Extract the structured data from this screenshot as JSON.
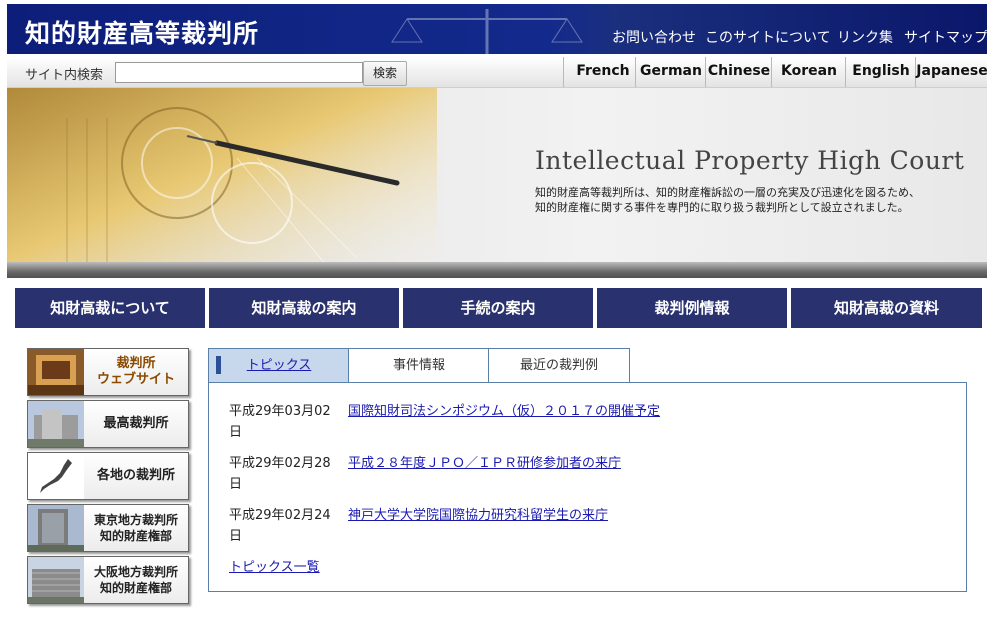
{
  "header": {
    "site_title": "知的財産高等裁判所",
    "links": [
      "お問い合わせ",
      "このサイトについて",
      "リンク集",
      "サイトマップ"
    ]
  },
  "search": {
    "label": "サイト内検索",
    "value": "",
    "placeholder": "",
    "button": "検索"
  },
  "languages": [
    "French",
    "German",
    "Chinese",
    "Korean",
    "English",
    "Japanese"
  ],
  "banner": {
    "title": "Intellectual Property High Court",
    "desc_line1": "知的財産高等裁判所は、知的財産権訴訟の一層の充実及び迅速化を図るため、",
    "desc_line2": "知的財産権に関する事件を専門的に取り扱う裁判所として設立されました。"
  },
  "main_nav": [
    "知財高裁について",
    "知財高裁の案内",
    "手続の案内",
    "裁判例情報",
    "知財高裁の資料"
  ],
  "side_links": [
    {
      "line1": "裁判所",
      "line2": "ウェブサイト"
    },
    {
      "line1": "最高裁判所",
      "line2": ""
    },
    {
      "line1": "各地の裁判所",
      "line2": ""
    },
    {
      "line1": "東京地方裁判所",
      "line2": "知的財産権部"
    },
    {
      "line1": "大阪地方裁判所",
      "line2": "知的財産権部"
    }
  ],
  "tabs": [
    "トピックス",
    "事件情報",
    "最近の裁判例"
  ],
  "topics": [
    {
      "date": "平成29年03月02",
      "day": "日",
      "title": "国際知財司法シンポジウム（仮）２０１７の開催予定"
    },
    {
      "date": "平成29年02月28",
      "day": "日",
      "title": "平成２８年度ＪＰＯ／ＩＰＲ研修参加者の来庁"
    },
    {
      "date": "平成29年02月24",
      "day": "日",
      "title": "神戸大学大学院国際協力研究科留学生の来庁"
    }
  ],
  "topics_all": "トピックス一覧",
  "colors": {
    "header_bg": "#132a8c",
    "nav_bg": "#29316e",
    "link": "#1a1ab0",
    "tab_active": "#c7d7ec"
  }
}
